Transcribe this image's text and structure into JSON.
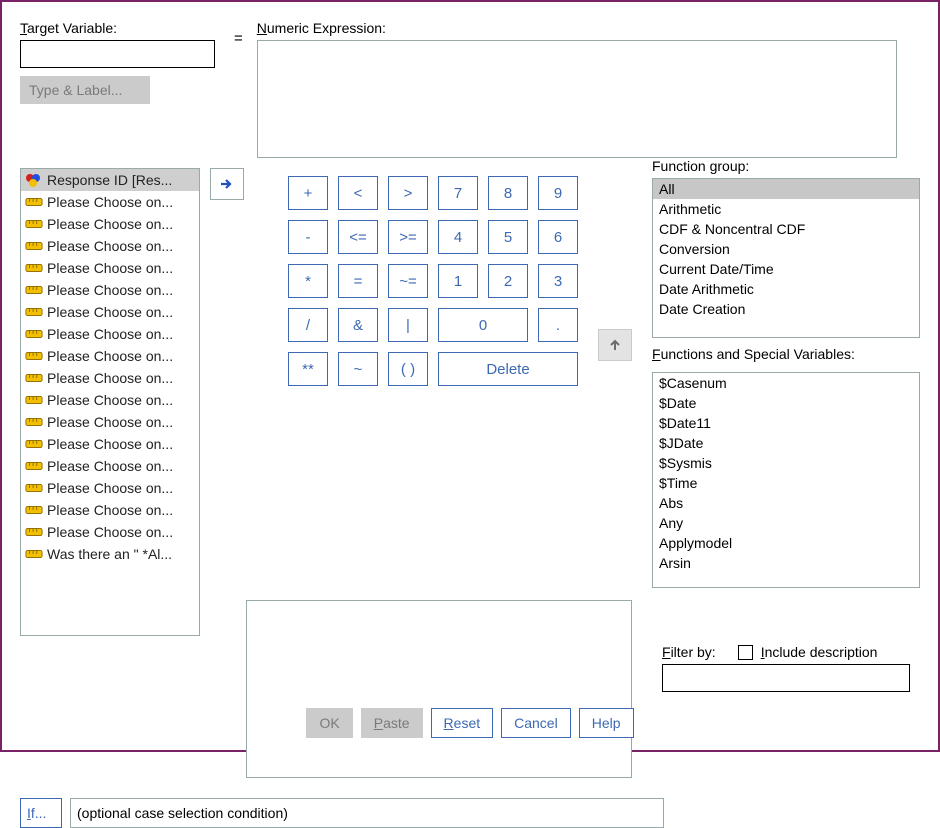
{
  "labels": {
    "target_variable": "Target Variable:",
    "numeric_expression": "Numeric Expression:",
    "type_and_label": "Type & Label...",
    "equals": "=",
    "function_group": "Function group:",
    "functions_special": "Functions and Special Variables:",
    "if_btn": "If...",
    "if_text": "(optional case selection condition)",
    "filter_by": "Filter by:",
    "include_desc": "Include description"
  },
  "target_value": "",
  "numeric_expression_value": "",
  "filter_value": "",
  "include_desc_checked": false,
  "variables": [
    {
      "label": "Response ID [Res...",
      "icon": "nominal",
      "selected": true
    },
    {
      "label": "Please Choose on...",
      "icon": "scale"
    },
    {
      "label": "Please Choose on...",
      "icon": "scale"
    },
    {
      "label": "Please Choose on...",
      "icon": "scale"
    },
    {
      "label": "Please Choose on...",
      "icon": "scale"
    },
    {
      "label": "Please Choose on...",
      "icon": "scale"
    },
    {
      "label": "Please Choose on...",
      "icon": "scale"
    },
    {
      "label": "Please Choose on...",
      "icon": "scale"
    },
    {
      "label": "Please Choose on...",
      "icon": "scale"
    },
    {
      "label": "Please Choose on...",
      "icon": "scale"
    },
    {
      "label": "Please Choose on...",
      "icon": "scale"
    },
    {
      "label": "Please Choose on...",
      "icon": "scale"
    },
    {
      "label": "Please Choose on...",
      "icon": "scale"
    },
    {
      "label": "Please Choose on...",
      "icon": "scale"
    },
    {
      "label": "Please Choose on...",
      "icon": "scale"
    },
    {
      "label": "Please Choose on...",
      "icon": "scale"
    },
    {
      "label": "Please Choose on...",
      "icon": "scale"
    },
    {
      "label": "Was there an \" *Al...",
      "icon": "scale"
    }
  ],
  "keypad": [
    [
      "+",
      "<",
      ">",
      "7",
      "8",
      "9"
    ],
    [
      "-",
      "<=",
      ">=",
      "4",
      "5",
      "6"
    ],
    [
      "*",
      "=",
      "~=",
      "1",
      "2",
      "3"
    ],
    [
      "/",
      "&",
      "|",
      "0",
      "."
    ],
    [
      "**",
      "~",
      "( )",
      "Delete"
    ]
  ],
  "function_groups": [
    {
      "label": "All",
      "selected": true
    },
    {
      "label": "Arithmetic"
    },
    {
      "label": "CDF & Noncentral CDF"
    },
    {
      "label": "Conversion"
    },
    {
      "label": "Current Date/Time"
    },
    {
      "label": "Date Arithmetic"
    },
    {
      "label": "Date Creation"
    }
  ],
  "functions": [
    "$Casenum",
    "$Date",
    "$Date11",
    "$JDate",
    "$Sysmis",
    "$Time",
    "Abs",
    "Any",
    "Applymodel",
    "Arsin"
  ],
  "footer": {
    "ok": "OK",
    "paste": "Paste",
    "reset": "Reset",
    "cancel": "Cancel",
    "help": "Help"
  }
}
